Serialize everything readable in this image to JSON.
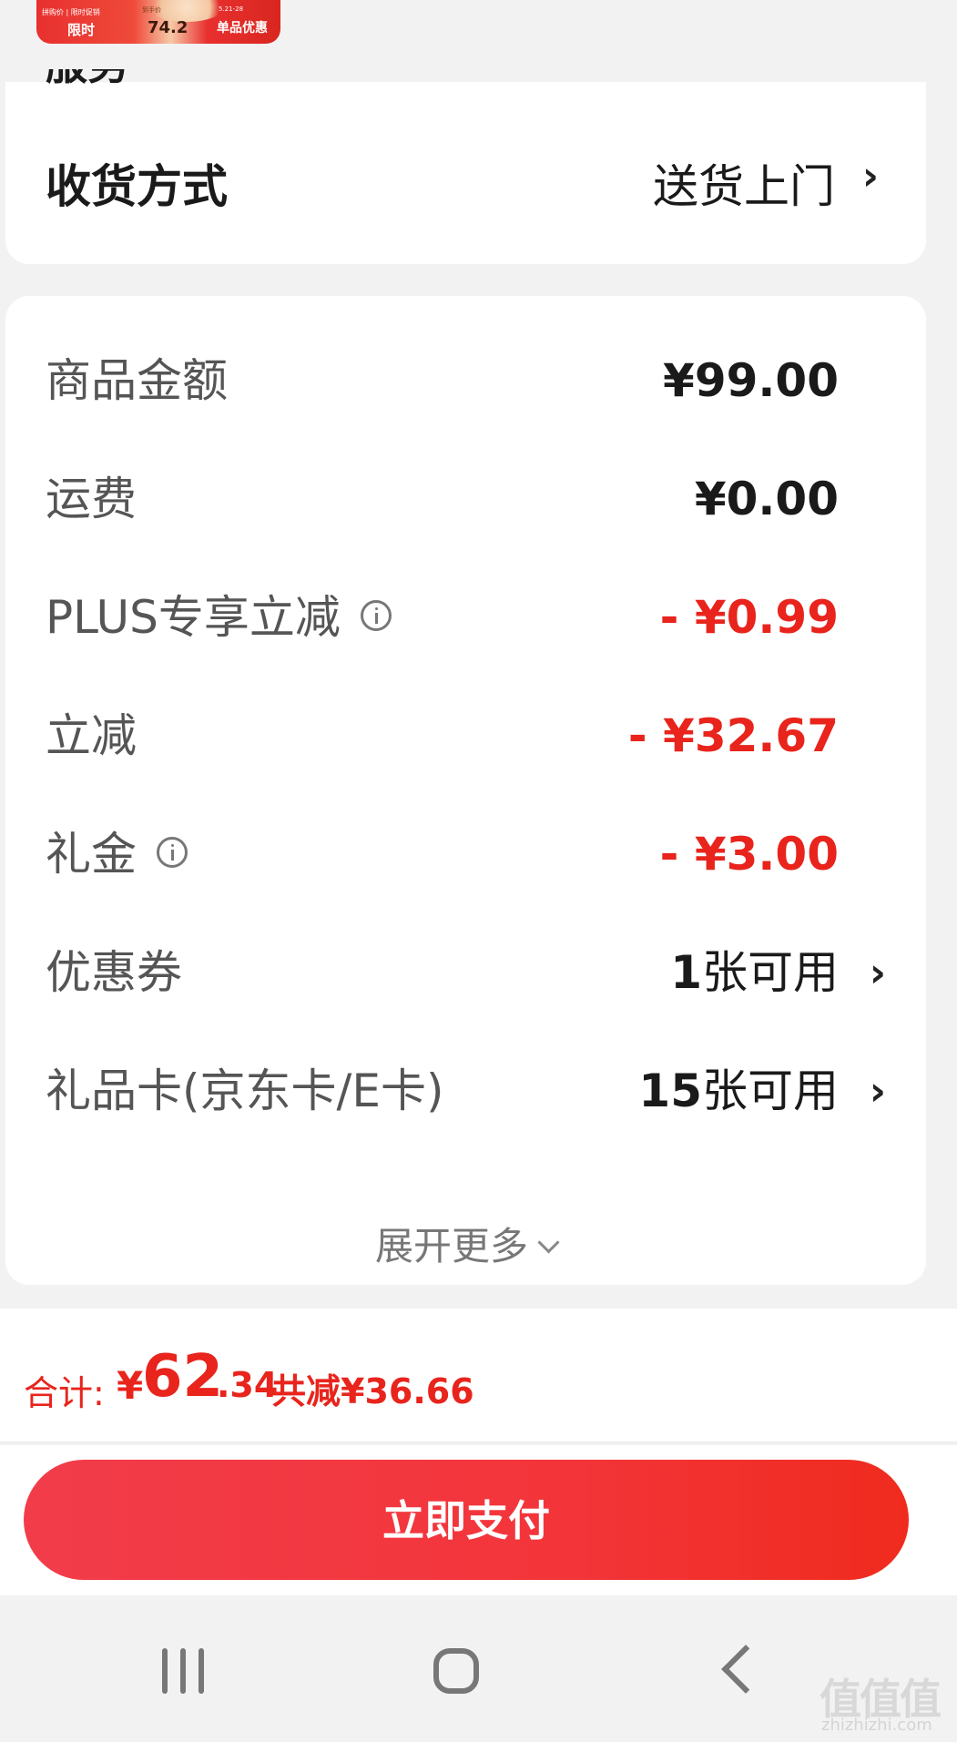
{
  "thumbnail": {
    "top_left_text": "拼购价 | 限时促销",
    "limit_label": "限时",
    "price_label": "到手价",
    "price": "74.2",
    "date_text": "5.21-28",
    "deal_label": "单品优惠"
  },
  "shipping": {
    "partial_label": "服务",
    "label": "收货方式",
    "value": "送货上门"
  },
  "price_rows": [
    {
      "label": "商品金额",
      "value": "¥99.00"
    },
    {
      "label": "运费",
      "value": "¥0.00"
    },
    {
      "label": "PLUS专享立减",
      "value": "- ¥0.99"
    },
    {
      "label": "立减",
      "value": "- ¥32.67"
    },
    {
      "label": "礼金",
      "value": "- ¥3.00"
    },
    {
      "label": "优惠券",
      "value_num": "1",
      "value_text": "张可用"
    },
    {
      "label": "礼品卡(京东卡/E卡)",
      "value_num": "15",
      "value_text": "张可用"
    }
  ],
  "expand_label": "展开更多",
  "total": {
    "label": "合计:",
    "currency": "¥",
    "integer": "62",
    "decimal": ".34",
    "saved": "共减¥36.66"
  },
  "pay_button": "立即支付",
  "watermark": {
    "main": "值值值",
    "sub": "zhizhizhi.com"
  },
  "colors": {
    "accent_red": "#e8241c",
    "button_gradient_start": "#f23c4a",
    "button_gradient_end": "#f02b1e"
  }
}
